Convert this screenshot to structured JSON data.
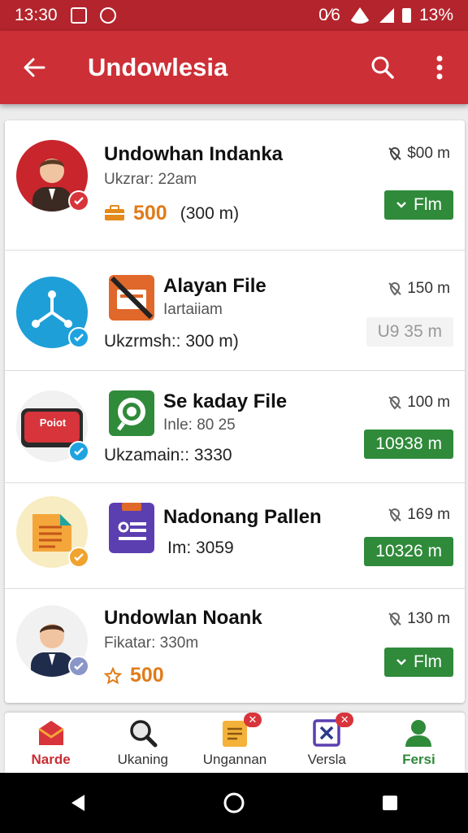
{
  "status_bar": {
    "time": "13:30",
    "network": "0⁄6",
    "battery": "13%"
  },
  "app_bar": {
    "title": "Undowlesia"
  },
  "items": [
    {
      "name": "Undowhan Indanka",
      "sub": "Ukzrar: 22am",
      "points": "500",
      "extra": "(300 m)",
      "distance": "$00 m",
      "action": "Flm"
    },
    {
      "name": "Alayan File",
      "sub": "Iartaiiam",
      "meta": "Ukzrmsh:: 300 m)",
      "distance": "150 m",
      "action": "U9 35 m"
    },
    {
      "name": "Se kaday File",
      "sub": "Inle: 80 25",
      "meta": "Ukzamain:: 3330",
      "distance": "100 m",
      "action": "10938 m",
      "badge": "Poiot"
    },
    {
      "name": "Nadonang Pallen",
      "meta": "Im: 3059",
      "distance": "169 m",
      "action": "10326 m"
    },
    {
      "name": "Undowlan Noank",
      "sub": "Fikatar: 330m",
      "points": "500",
      "distance": "130 m",
      "action": "Flm"
    }
  ],
  "bottom_nav": [
    {
      "label": "Narde"
    },
    {
      "label": "Ukaning"
    },
    {
      "label": "Ungannan"
    },
    {
      "label": "Versla"
    },
    {
      "label": "Fersi"
    }
  ],
  "colors": {
    "primary": "#cd2f36",
    "status_bar": "#b3242c",
    "accent_green": "#2f8a3a",
    "points_orange": "#e07b1a"
  }
}
